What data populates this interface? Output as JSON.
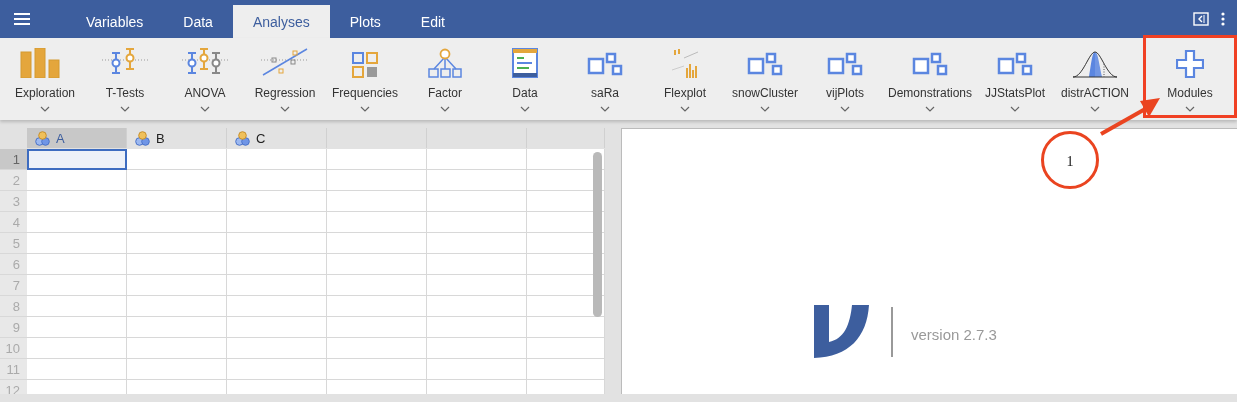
{
  "menu_tabs": [
    {
      "label": "Variables",
      "selected": false
    },
    {
      "label": "Data",
      "selected": false
    },
    {
      "label": "Analyses",
      "selected": true
    },
    {
      "label": "Plots",
      "selected": false
    },
    {
      "label": "Edit",
      "selected": false
    }
  ],
  "ribbon": [
    {
      "label": "Exploration",
      "kind": "bars",
      "highlighted": false
    },
    {
      "label": "T-Tests",
      "kind": "ttest",
      "highlighted": false
    },
    {
      "label": "ANOVA",
      "kind": "anova",
      "highlighted": false
    },
    {
      "label": "Regression",
      "kind": "regression",
      "highlighted": false
    },
    {
      "label": "Frequencies",
      "kind": "frequencies",
      "highlighted": false
    },
    {
      "label": "Factor",
      "kind": "factor",
      "highlighted": false
    },
    {
      "label": "Data",
      "kind": "data",
      "highlighted": false
    },
    {
      "label": "saRa",
      "kind": "module",
      "highlighted": false
    },
    {
      "label": "Flexplot",
      "kind": "flexplot",
      "highlighted": false
    },
    {
      "label": "snowCluster",
      "kind": "module",
      "highlighted": false
    },
    {
      "label": "vijPlots",
      "kind": "module",
      "highlighted": false
    },
    {
      "label": "Demonstrations",
      "kind": "module",
      "highlighted": false
    },
    {
      "label": "JJStatsPlot",
      "kind": "module",
      "highlighted": false
    },
    {
      "label": "distrACTION",
      "kind": "distribution",
      "highlighted": false
    },
    {
      "label": "Modules",
      "kind": "plus",
      "highlighted": true
    }
  ],
  "callout": {
    "label": "1"
  },
  "spreadsheet": {
    "columns": [
      {
        "name": "A",
        "selected": true
      },
      {
        "name": "B",
        "selected": false
      },
      {
        "name": "C",
        "selected": false
      }
    ],
    "rows": [
      {
        "label": "1",
        "selected": true
      },
      {
        "label": "2",
        "selected": false
      },
      {
        "label": "3",
        "selected": false
      },
      {
        "label": "4",
        "selected": false
      },
      {
        "label": "5",
        "selected": false
      },
      {
        "label": "6",
        "selected": false
      },
      {
        "label": "7",
        "selected": false
      },
      {
        "label": "8",
        "selected": false
      },
      {
        "label": "9",
        "selected": false
      },
      {
        "label": "10",
        "selected": false
      },
      {
        "label": "11",
        "selected": false
      },
      {
        "label": "12",
        "selected": false
      }
    ]
  },
  "results": {
    "version": "version 2.7.3"
  }
}
